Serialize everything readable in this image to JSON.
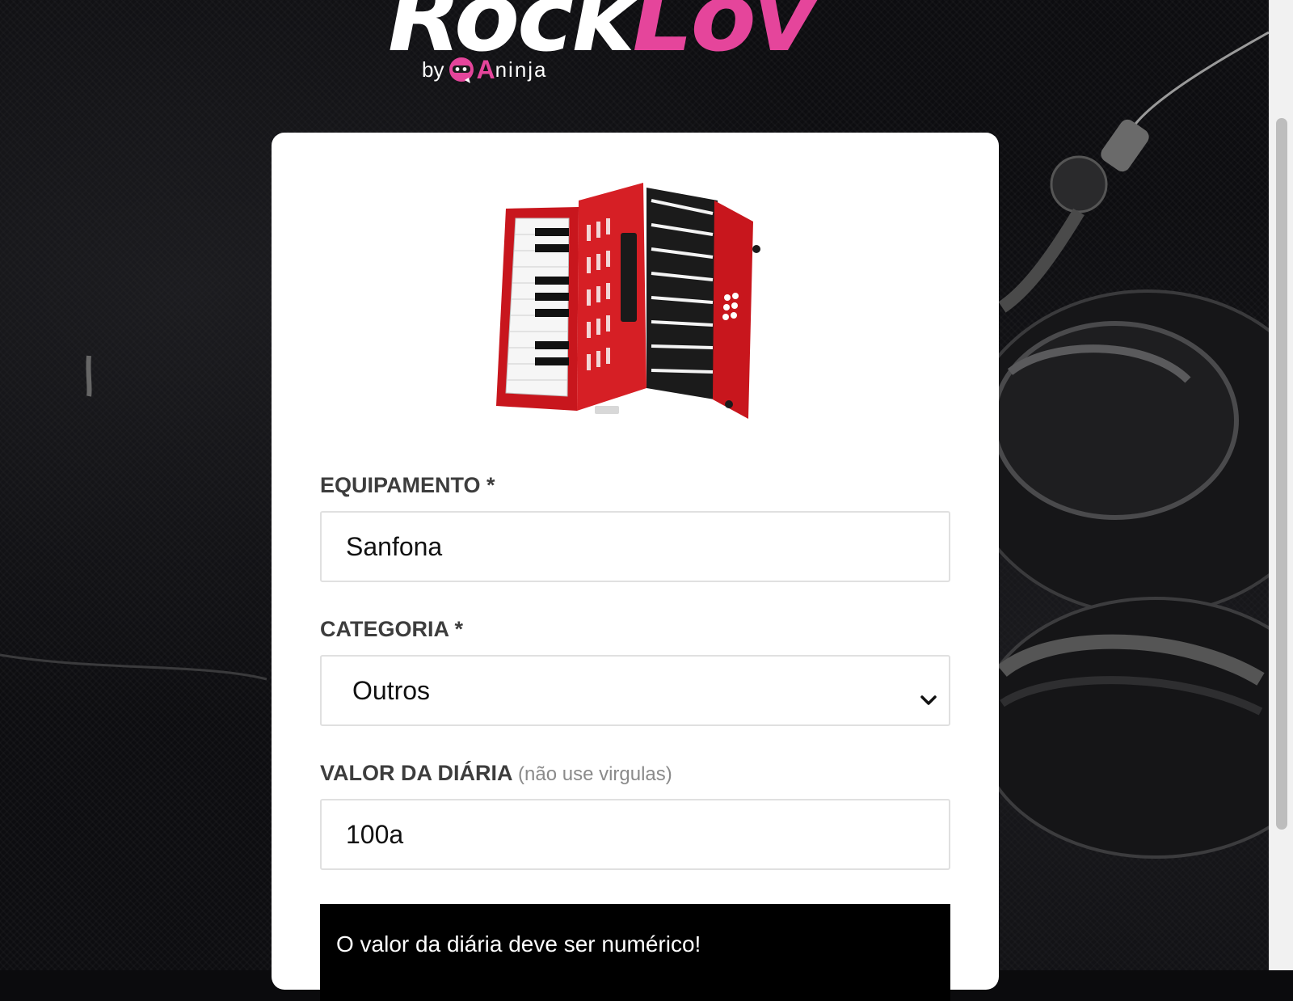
{
  "logo": {
    "brand_part1": "Rock",
    "brand_part2": "Lov",
    "by": "by",
    "qa_a": "A",
    "org": "ninja"
  },
  "form": {
    "equipment": {
      "label": "EQUIPAMENTO *",
      "value": "Sanfona"
    },
    "category": {
      "label": "CATEGORIA *",
      "selected": "Outros"
    },
    "daily_price": {
      "label": "VALOR DA DIÁRIA",
      "hint": "(não use virgulas)",
      "value": "100a"
    }
  },
  "alert": {
    "message": "O valor da diária deve ser numérico!"
  },
  "colors": {
    "brand_pink": "#e5459b",
    "alert_bg": "#000000",
    "label_text": "#3d3d3d"
  }
}
